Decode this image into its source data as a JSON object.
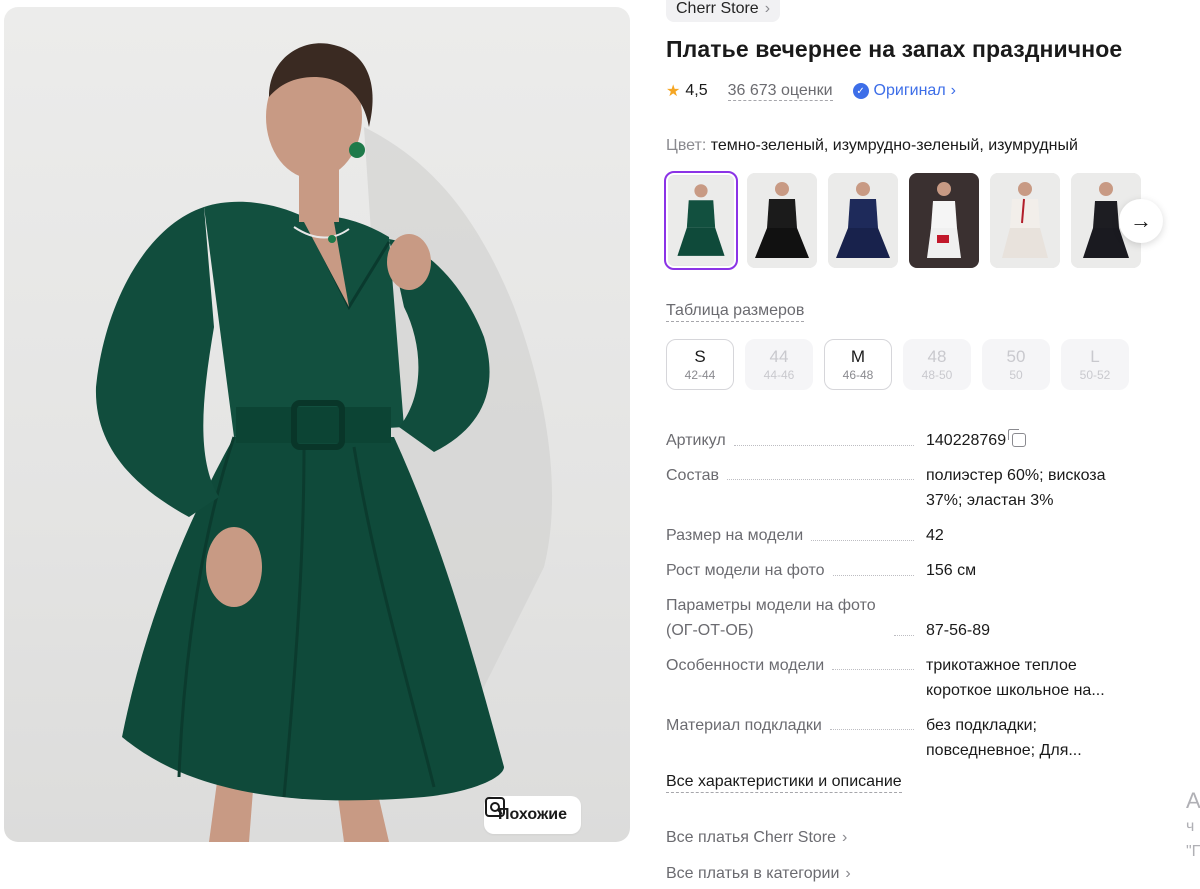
{
  "brand": {
    "name": "Cherr Store"
  },
  "product": {
    "title": "Платье вечернее на запах праздничное",
    "rating": "4,5",
    "reviews": "36 673 оценки",
    "original_label": "Оригинал"
  },
  "color": {
    "label": "Цвет:",
    "value": "темно-зеленый, изумрудно-зеленый, изумрудный"
  },
  "similar_button": "Похожие",
  "size_table_link": "Таблица размеров",
  "sizes": [
    {
      "label": "S",
      "sub": "42-44",
      "available": true
    },
    {
      "label": "44",
      "sub": "44-46",
      "available": false
    },
    {
      "label": "M",
      "sub": "46-48",
      "available": true
    },
    {
      "label": "48",
      "sub": "48-50",
      "available": false
    },
    {
      "label": "50",
      "sub": "50",
      "available": false
    },
    {
      "label": "L",
      "sub": "50-52",
      "available": false
    }
  ],
  "specs": [
    {
      "key": "Артикул",
      "value": "140228769"
    },
    {
      "key": "Состав",
      "value": "полиэстер 60%; вискоза 37%; эластан 3%"
    },
    {
      "key": "Размер на модели",
      "value": "42"
    },
    {
      "key": "Рост модели на фото",
      "value": "156 см"
    },
    {
      "key": "Параметры модели на фото (ОГ-ОТ-ОБ)",
      "value": "87-56-89"
    },
    {
      "key": "Особенности модели",
      "value": "трикотажное теплое короткое школьное на..."
    },
    {
      "key": "Материал подкладки",
      "value": "без подкладки; повседневное; Для..."
    }
  ],
  "all_characteristics": "Все характеристики и описание",
  "links": {
    "all_brand": "Все платья Cherr Store",
    "all_category": "Все платья в категории"
  },
  "edge_text": [
    "А",
    "ч",
    "\"Г"
  ],
  "colors": {
    "accent_purple": "#8b33e6",
    "link_blue": "#3d6ee8",
    "star": "#f5a623",
    "dress_green": "#0f4a3a"
  }
}
